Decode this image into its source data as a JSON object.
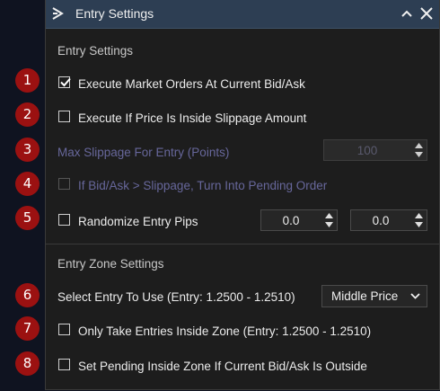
{
  "window": {
    "title": "Entry Settings"
  },
  "entry_settings": {
    "section_title": "Entry Settings",
    "execute_market": {
      "label": "Execute Market Orders At Current Bid/Ask",
      "checked": true
    },
    "execute_inside_slippage": {
      "label": "Execute If Price Is Inside Slippage Amount",
      "checked": false
    },
    "max_slippage": {
      "label": "Max Slippage For Entry (Points)",
      "value": "100"
    },
    "pending_if_slippage": {
      "label": "If Bid/Ask > Slippage, Turn Into Pending Order",
      "checked": false
    },
    "randomize_pips": {
      "label": "Randomize Entry Pips",
      "checked": false,
      "min_value": "0.0",
      "max_value": "0.0"
    }
  },
  "entry_zone": {
    "section_title": "Entry Zone Settings",
    "select_entry": {
      "label": "Select Entry To Use (Entry: 1.2500 - 1.2510)",
      "selected": "Middle Price"
    },
    "only_inside_zone": {
      "label": "Only Take Entries Inside Zone (Entry: 1.2500 - 1.2510)",
      "checked": false
    },
    "pending_inside_zone": {
      "label": "Set Pending Inside Zone If Current Bid/Ask Is Outside",
      "checked": false
    }
  },
  "badges": [
    "1",
    "2",
    "3",
    "4",
    "5",
    "6",
    "7",
    "8"
  ],
  "colors": {
    "titlebar": "#2d3e53",
    "panel": "#1d1d1d",
    "badge": "#9b1111",
    "disabled_text": "#67679b"
  }
}
